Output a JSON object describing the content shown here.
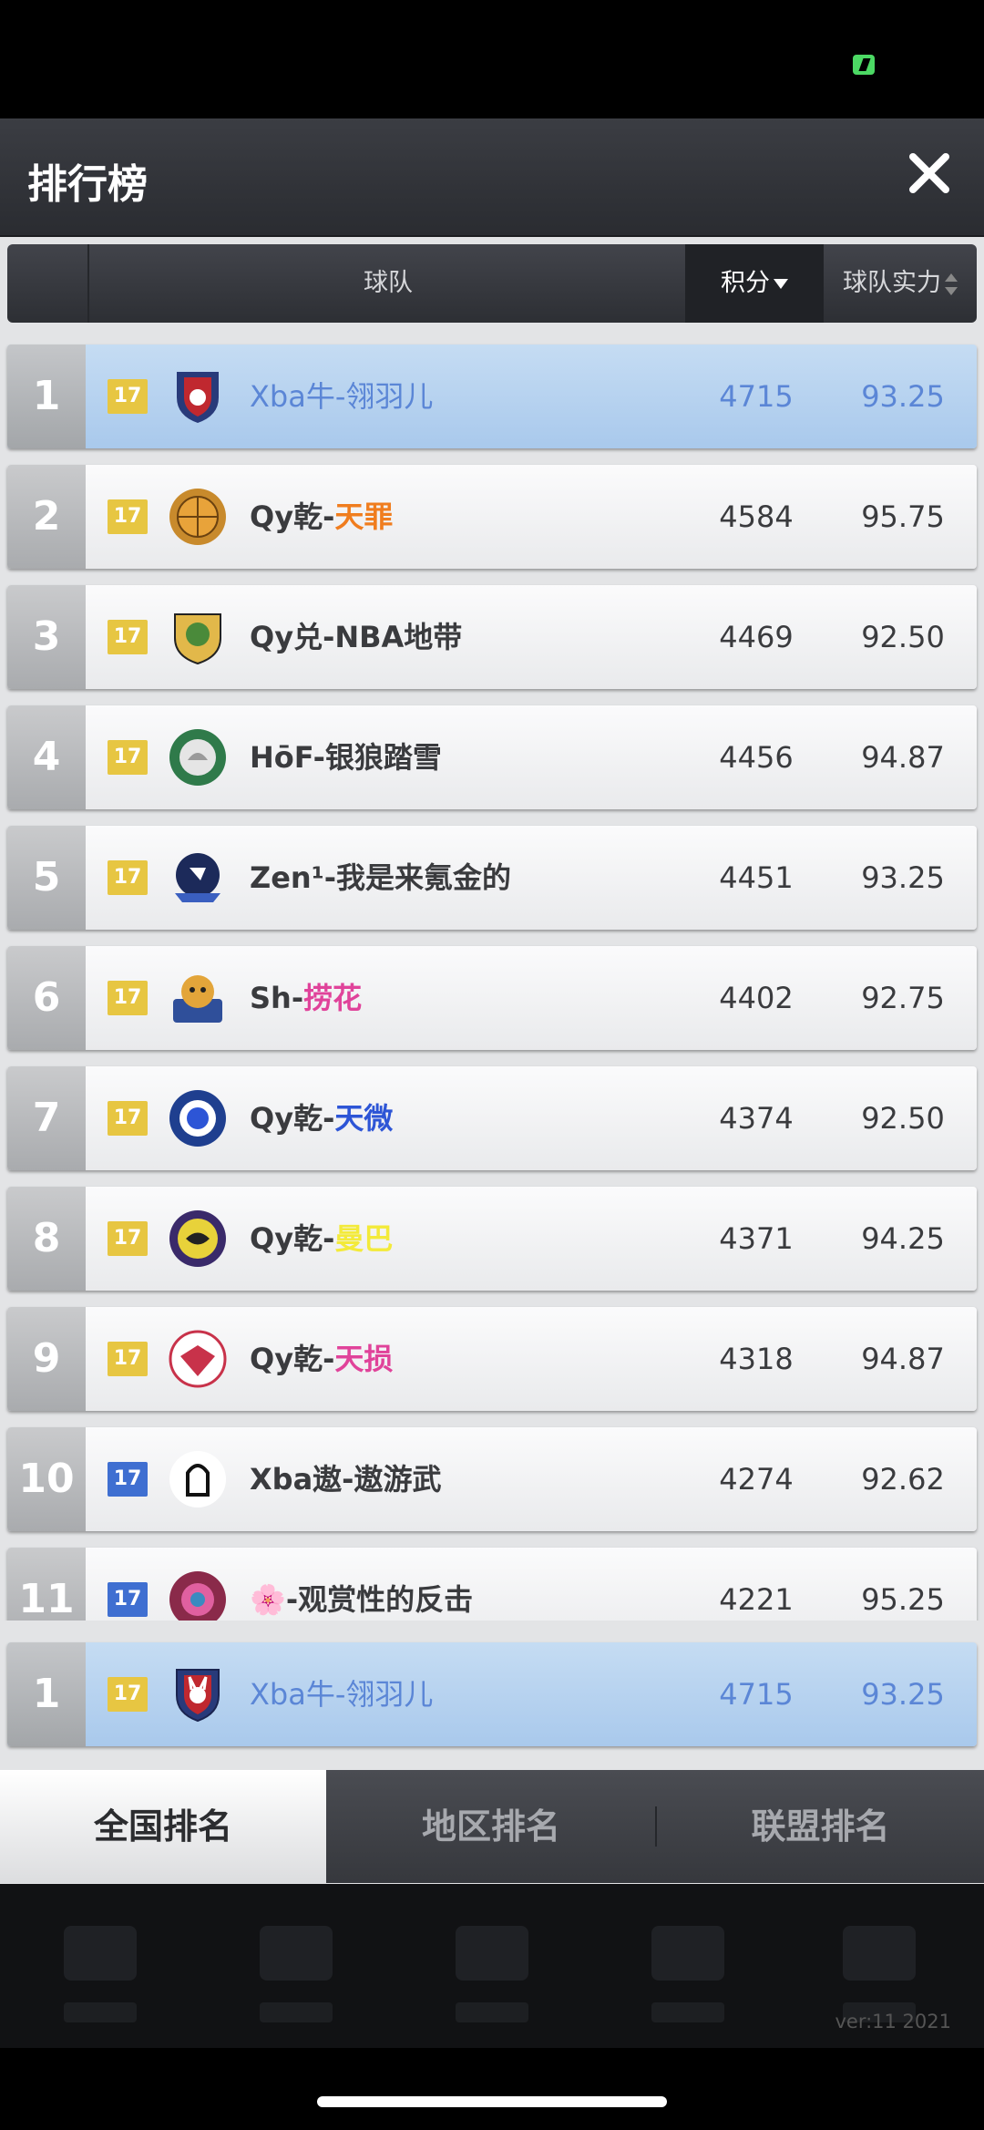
{
  "title": "排行榜",
  "header": {
    "team": "球队",
    "score": "积分",
    "power": "球队实力"
  },
  "rows": [
    {
      "rank": "1",
      "level": "17",
      "level_color": "gold",
      "name_prefix": "Xba牛-",
      "name_suffix": "翎羽儿",
      "suffix_color": "#5b86d6",
      "score": "4715",
      "power": "93.25",
      "logo": "rabbit-shield-logo",
      "me": true
    },
    {
      "rank": "2",
      "level": "17",
      "level_color": "gold",
      "name_prefix": "Qy乾-",
      "name_suffix": "天罪",
      "suffix_color": "#f07d1e",
      "score": "4584",
      "power": "95.75",
      "logo": "basketball-gear-logo"
    },
    {
      "rank": "3",
      "level": "17",
      "level_color": "gold",
      "name_prefix": "Qy兑-NBA地带",
      "name_suffix": "",
      "suffix_color": "",
      "score": "4469",
      "power": "92.50",
      "logo": "dragon-shield-logo"
    },
    {
      "rank": "4",
      "level": "17",
      "level_color": "gold",
      "name_prefix": "HōF-银狼踏雪",
      "name_suffix": "",
      "suffix_color": "",
      "score": "4456",
      "power": "94.87",
      "logo": "wolf-gear-logo"
    },
    {
      "rank": "5",
      "level": "17",
      "level_color": "gold",
      "name_prefix": "Zen¹-我是来氪金的",
      "name_suffix": "",
      "suffix_color": "",
      "score": "4451",
      "power": "93.25",
      "logo": "eagle-logo"
    },
    {
      "rank": "6",
      "level": "17",
      "level_color": "gold",
      "name_prefix": "Sh-",
      "name_suffix": "捞花",
      "suffix_color": "#e0439a",
      "score": "4402",
      "power": "92.75",
      "logo": "tiger-logo"
    },
    {
      "rank": "7",
      "level": "17",
      "level_color": "gold",
      "name_prefix": "Qy乾-",
      "name_suffix": "天微",
      "suffix_color": "#2d55d6",
      "score": "4374",
      "power": "92.50",
      "logo": "star-circle-logo"
    },
    {
      "rank": "8",
      "level": "17",
      "level_color": "gold",
      "name_prefix": "Qy乾-",
      "name_suffix": "曼巴",
      "suffix_color": "#f3ea3a",
      "score": "4371",
      "power": "94.25",
      "logo": "snake-logo"
    },
    {
      "rank": "9",
      "level": "17",
      "level_color": "gold",
      "name_prefix": "Qy乾-",
      "name_suffix": "天损",
      "suffix_color": "#e0439a",
      "score": "4318",
      "power": "94.87",
      "logo": "bird-logo"
    },
    {
      "rank": "10",
      "level": "17",
      "level_color": "blue",
      "name_prefix": "Xba遨-遨游武",
      "name_suffix": "",
      "suffix_color": "",
      "score": "4274",
      "power": "92.62",
      "logo": "knight-logo"
    },
    {
      "rank": "11",
      "level": "17",
      "level_color": "blue",
      "name_prefix": "🌸-观赏性的反击",
      "name_suffix": "",
      "suffix_color": "",
      "score": "4221",
      "power": "95.25",
      "logo": "flower-logo"
    }
  ],
  "my_rank": {
    "rank": "1",
    "level": "17",
    "name_prefix": "Xba牛-",
    "name_suffix": "翎羽儿",
    "score": "4715",
    "power": "93.25"
  },
  "tabs": [
    "全国排名",
    "地区排名",
    "联盟排名"
  ],
  "active_tab": 0,
  "version": "ver:11  2021"
}
